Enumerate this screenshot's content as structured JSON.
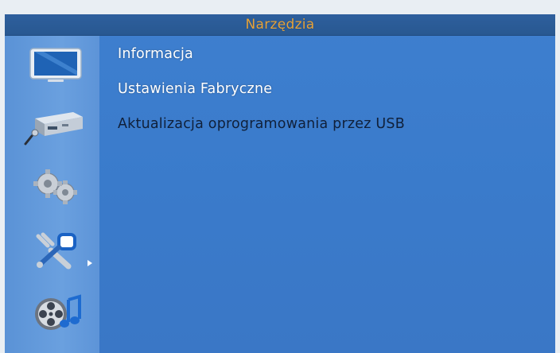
{
  "header": {
    "title": "Narzędzia"
  },
  "sidebar": {
    "icons": [
      {
        "name": "monitor-icon"
      },
      {
        "name": "receiver-icon"
      },
      {
        "name": "gears-icon"
      },
      {
        "name": "tools-icon",
        "active": true
      },
      {
        "name": "media-icon"
      }
    ]
  },
  "menu": {
    "items": [
      {
        "label": "Informacja"
      },
      {
        "label": "Ustawienia Fabryczne"
      },
      {
        "label": "Aktualizacja oprogramowania przez USB",
        "selected": true
      }
    ]
  },
  "colors": {
    "title": "#e6a33b",
    "background": "#3a7bcb",
    "header": "#2b5b96",
    "sidebar": "#6aa0df"
  }
}
